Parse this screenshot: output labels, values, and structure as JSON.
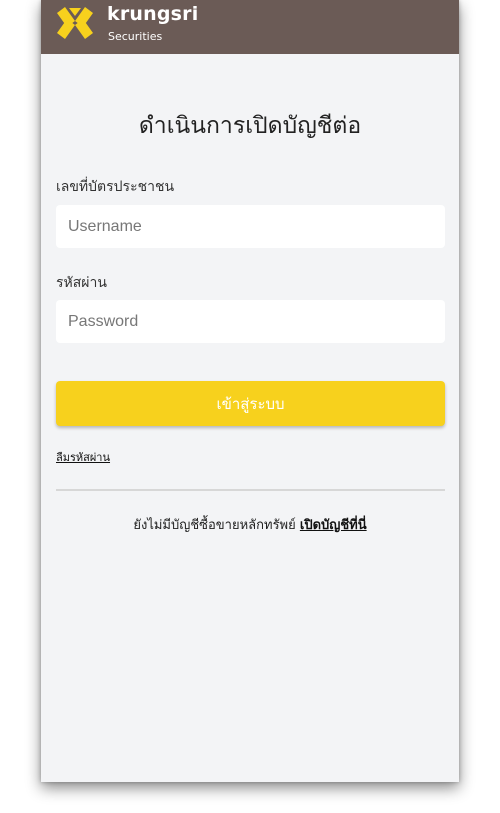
{
  "brand": {
    "name": "krungsri",
    "subtitle": "Securities"
  },
  "page": {
    "title": "ดำเนินการเปิดบัญชีต่อ"
  },
  "form": {
    "id_label": "เลขที่บัตรประชาชน",
    "id_placeholder": "Username",
    "password_label": "รหัสผ่าน",
    "password_placeholder": "Password",
    "login_button": "เข้าสู่ระบบ",
    "forgot_password": "ลืมรหัสผ่าน"
  },
  "signup": {
    "prompt": "ยังไม่มีบัญชีซื้อขายหลักทรัพย์",
    "link": "เปิดบัญชีที่นี่"
  },
  "colors": {
    "header_bg": "#6b5b56",
    "accent_yellow": "#f7d11d",
    "page_bg": "#f3f4f6"
  },
  "icons": {
    "logo": "krungsri-logo-icon"
  }
}
